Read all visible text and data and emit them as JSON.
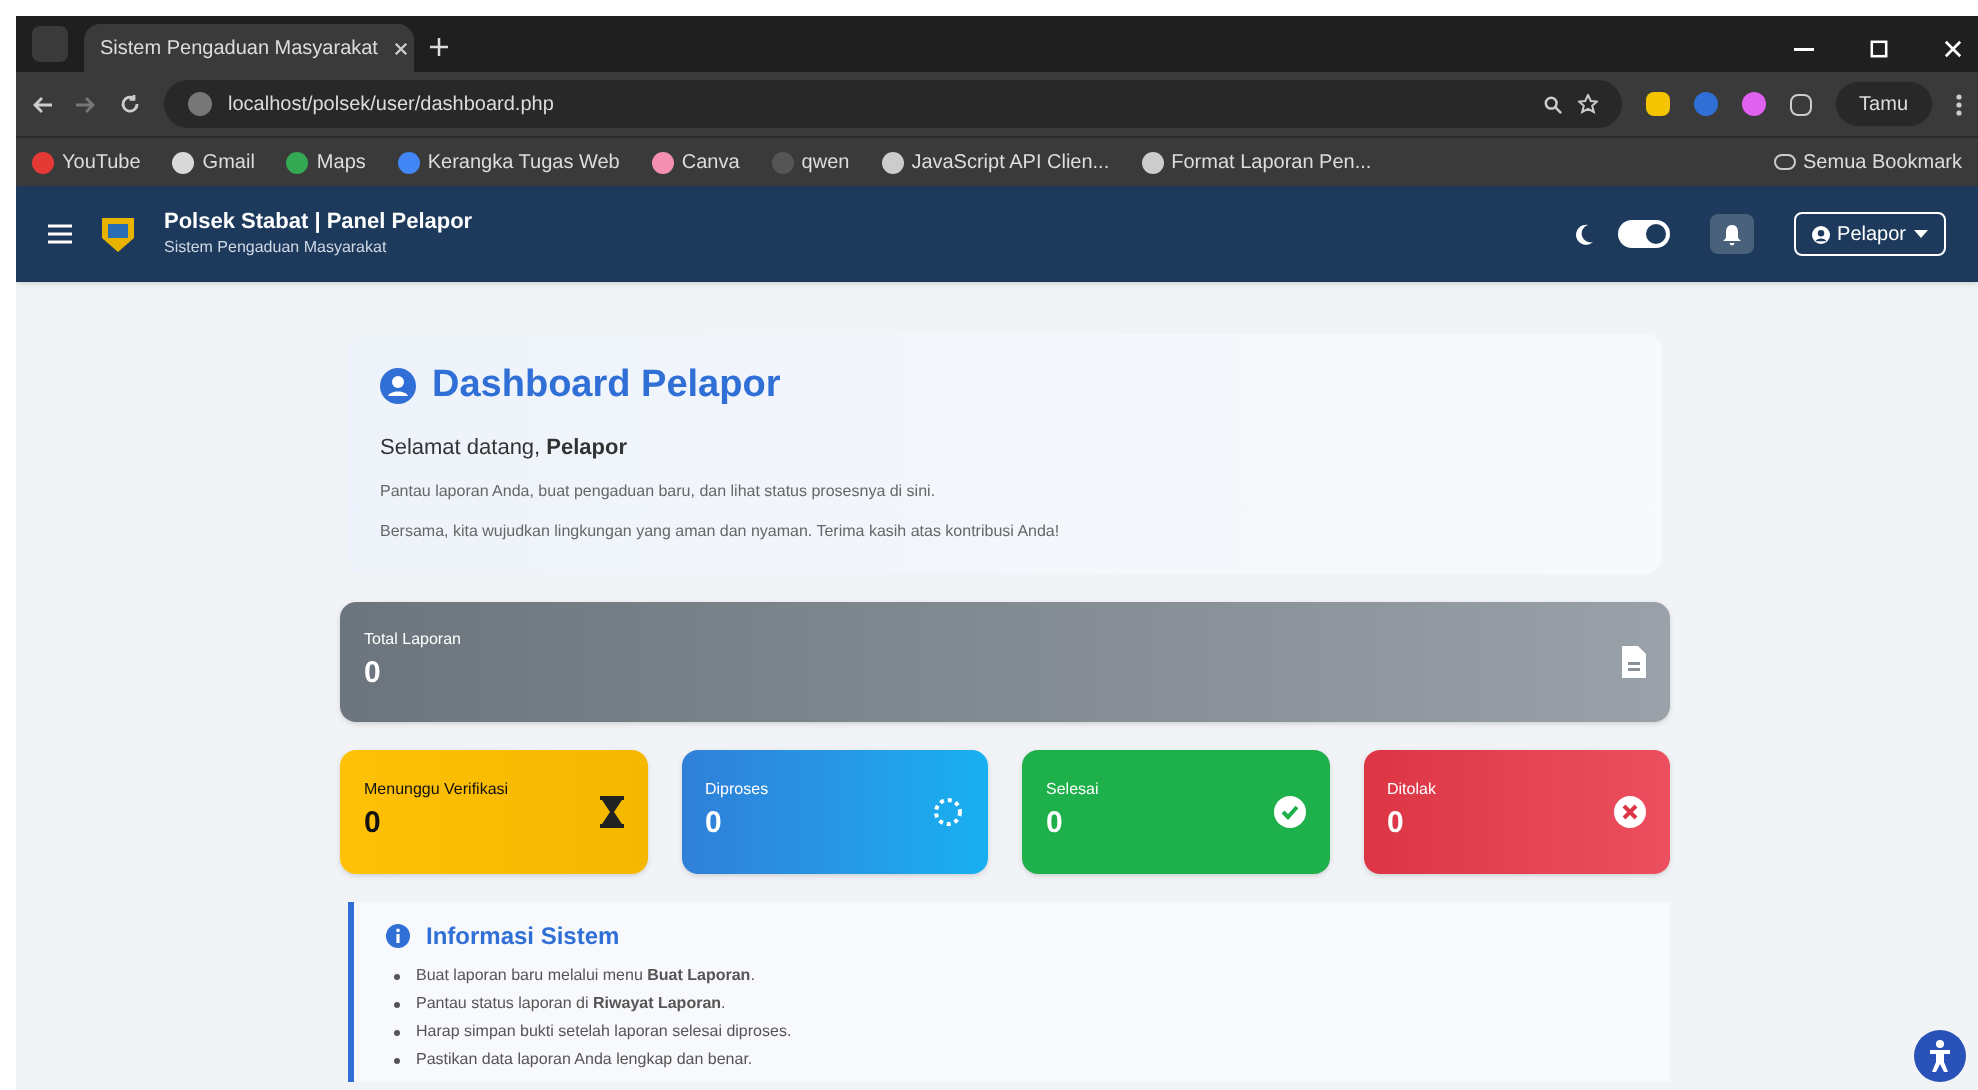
{
  "browser": {
    "tab_title": "Sistem Pengaduan Masyarakat",
    "url": "localhost/polsek/user/dashboard.php",
    "profile": "Tamu",
    "bookmarks": [
      {
        "label": "YouTube",
        "color": "#e53935"
      },
      {
        "label": "Gmail",
        "color": "#d9d9d9"
      },
      {
        "label": "Maps",
        "color": "#34a853"
      },
      {
        "label": "Kerangka Tugas Web",
        "color": "#4285f4"
      },
      {
        "label": "Canva",
        "color": "#f48fb1"
      },
      {
        "label": "qwen",
        "color": "#555555"
      },
      {
        "label": "JavaScript API Clien...",
        "color": "#cccccc"
      },
      {
        "label": "Format Laporan Pen...",
        "color": "#cccccc"
      }
    ],
    "all_bookmarks": "Semua Bookmark"
  },
  "header": {
    "title": "Polsek Stabat | Panel Pelapor",
    "subtitle": "Sistem Pengaduan Masyarakat",
    "dark_mode": true,
    "user": "Pelapor"
  },
  "welcome": {
    "title": "Dashboard Pelapor",
    "greeting": "Selamat datang, **Pelapor**",
    "lines": [
      "Pantau laporan Anda, buat pengaduan baru, dan lihat status prosesnya di sini.",
      "Bersama, kita wujudkan lingkungan yang aman dan nyaman. Terima kasih atas kontribusi Anda!"
    ]
  },
  "total": {
    "label": "Total Laporan",
    "value": "0"
  },
  "stats": [
    {
      "kind": "waiting",
      "label": "Menunggu Verifikasi",
      "value": "0"
    },
    {
      "kind": "process",
      "label": "Diproses",
      "value": "0"
    },
    {
      "kind": "done",
      "label": "Selesai",
      "value": "0"
    },
    {
      "kind": "rejected",
      "label": "Ditolak",
      "value": "0"
    }
  ],
  "info": {
    "title": "Informasi Sistem",
    "items": [
      "Buat laporan baru melalui menu **Buat Laporan**.",
      "Pantau status laporan di **Riwayat Laporan**.",
      "Harap simpan bukti setelah laporan selesai diproses.",
      "Pastikan data laporan Anda lengkap dan benar."
    ]
  }
}
